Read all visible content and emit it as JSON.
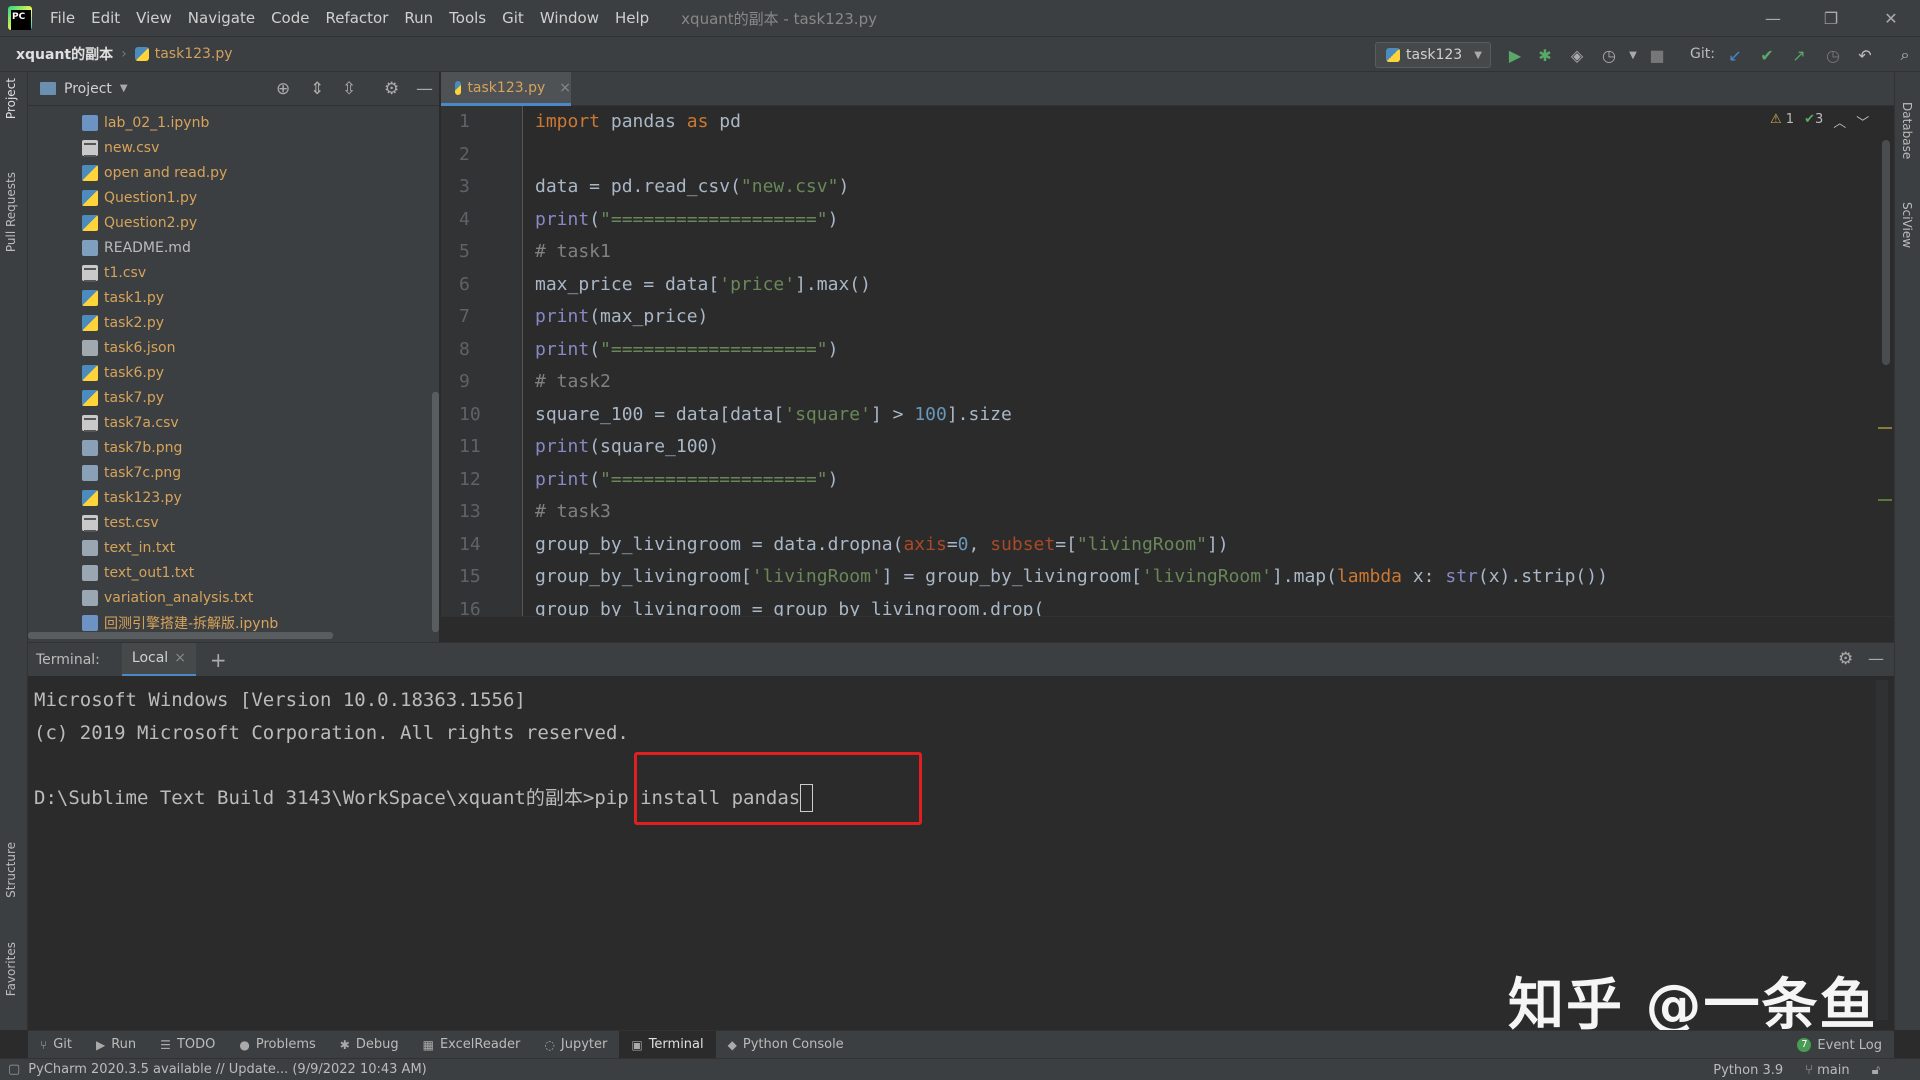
{
  "menubar": {
    "items": [
      "File",
      "Edit",
      "View",
      "Navigate",
      "Code",
      "Refactor",
      "Run",
      "Tools",
      "Git",
      "Window",
      "Help"
    ],
    "window_title": "xquant的副本 - task123.py",
    "minimize": "—",
    "restore": "❐",
    "close": "✕"
  },
  "navbar": {
    "project": "xquant的副本",
    "file": "task123.py",
    "run_config": "task123",
    "git_label": "Git:"
  },
  "left_strip": {
    "project": "Project",
    "pull_requests": "Pull Requests",
    "structure": "Structure",
    "favorites": "Favorites"
  },
  "right_strip": {
    "database": "Database",
    "sciview": "SciView"
  },
  "project_panel": {
    "title": "Project",
    "files": [
      {
        "name": "lab_02_1.ipynb",
        "type": "nb"
      },
      {
        "name": "new.csv",
        "type": "csv"
      },
      {
        "name": "open and read.py",
        "type": "py"
      },
      {
        "name": "Question1.py",
        "type": "py"
      },
      {
        "name": "Question2.py",
        "type": "py"
      },
      {
        "name": "README.md",
        "type": "md"
      },
      {
        "name": "t1.csv",
        "type": "csv"
      },
      {
        "name": "task1.py",
        "type": "py"
      },
      {
        "name": "task2.py",
        "type": "py"
      },
      {
        "name": "task6.json",
        "type": "json"
      },
      {
        "name": "task6.py",
        "type": "py"
      },
      {
        "name": "task7.py",
        "type": "py"
      },
      {
        "name": "task7a.csv",
        "type": "csv"
      },
      {
        "name": "task7b.png",
        "type": "png"
      },
      {
        "name": "task7c.png",
        "type": "png"
      },
      {
        "name": "task123.py",
        "type": "py"
      },
      {
        "name": "test.csv",
        "type": "csv"
      },
      {
        "name": "text_in.txt",
        "type": "txt"
      },
      {
        "name": "text_out1.txt",
        "type": "txt"
      },
      {
        "name": "variation_analysis.txt",
        "type": "txt"
      },
      {
        "name": "回测引擎搭建-拆解版.ipynb",
        "type": "nb"
      }
    ]
  },
  "editor": {
    "tab": "task123.py",
    "inspections": {
      "warnings": "1",
      "ok": "3"
    },
    "line_numbers": [
      "1",
      "2",
      "3",
      "4",
      "5",
      "6",
      "7",
      "8",
      "9",
      "10",
      "11",
      "12",
      "13",
      "14",
      "15",
      "16"
    ],
    "lines": [
      [
        [
          "kw",
          "import"
        ],
        [
          "fn",
          " pandas "
        ],
        [
          "kw",
          "as"
        ],
        [
          "fn",
          " pd"
        ]
      ],
      [],
      [
        [
          "fn",
          "data = pd.read_csv("
        ],
        [
          "st",
          "\"new.csv\""
        ],
        [
          "fn",
          ")"
        ]
      ],
      [
        [
          "bi",
          "print"
        ],
        [
          "fn",
          "("
        ],
        [
          "st",
          "\"===================\""
        ],
        [
          "fn",
          ")"
        ]
      ],
      [
        [
          "cm",
          "# task1"
        ]
      ],
      [
        [
          "fn",
          "max_price = data["
        ],
        [
          "st",
          "'price'"
        ],
        [
          "fn",
          "].max()"
        ]
      ],
      [
        [
          "bi",
          "print"
        ],
        [
          "fn",
          "(max_price)"
        ]
      ],
      [
        [
          "bi",
          "print"
        ],
        [
          "fn",
          "("
        ],
        [
          "st",
          "\"===================\""
        ],
        [
          "fn",
          ")"
        ]
      ],
      [
        [
          "cm",
          "# task2"
        ]
      ],
      [
        [
          "fn",
          "square_100 = data[data["
        ],
        [
          "st",
          "'square'"
        ],
        [
          "fn",
          "] > "
        ],
        [
          "nm",
          "100"
        ],
        [
          "fn",
          "].size"
        ]
      ],
      [
        [
          "bi",
          "print"
        ],
        [
          "fn",
          "(square_100)"
        ]
      ],
      [
        [
          "bi",
          "print"
        ],
        [
          "fn",
          "("
        ],
        [
          "st",
          "\"===================\""
        ],
        [
          "fn",
          ")"
        ]
      ],
      [
        [
          "cm",
          "# task3"
        ]
      ],
      [
        [
          "fn",
          "group_by_livingroom = data.dropna("
        ],
        [
          "pr",
          "axis"
        ],
        [
          "fn",
          "="
        ],
        [
          "nm",
          "0"
        ],
        [
          "fn",
          ", "
        ],
        [
          "pr",
          "subset"
        ],
        [
          "fn",
          "=["
        ],
        [
          "st",
          "\"livingRoom\""
        ],
        [
          "fn",
          "])"
        ]
      ],
      [
        [
          "fn",
          "group_by_livingroom["
        ],
        [
          "st",
          "'livingRoom'"
        ],
        [
          "fn",
          "] = group_by_livingroom["
        ],
        [
          "st",
          "'livingRoom'"
        ],
        [
          "fn",
          "].map("
        ],
        [
          "kw",
          "lambda"
        ],
        [
          "fn",
          " x: "
        ],
        [
          "bi",
          "str"
        ],
        [
          "fn",
          "(x).strip())"
        ]
      ],
      [
        [
          "fn",
          "group_by_livingroom = group_by_livingroom.drop("
        ]
      ]
    ]
  },
  "terminal": {
    "label": "Terminal:",
    "tab": "Local",
    "lines": [
      "Microsoft Windows [Version 10.0.18363.1556]",
      "(c) 2019 Microsoft Corporation. All rights reserved.",
      ""
    ],
    "prompt": "D:\\Sublime Text Build 3143\\WorkSpace\\xquant的副本",
    "command": ">pip install pandas"
  },
  "watermark": "知乎 @一条鱼",
  "toolwindows": [
    {
      "label": "Git",
      "icon": "⑂"
    },
    {
      "label": "Run",
      "icon": "▶"
    },
    {
      "label": "TODO",
      "icon": "☰"
    },
    {
      "label": "Problems",
      "icon": "●"
    },
    {
      "label": "Debug",
      "icon": "✱"
    },
    {
      "label": "ExcelReader",
      "icon": "▦"
    },
    {
      "label": "Jupyter",
      "icon": "◌"
    },
    {
      "label": "Terminal",
      "icon": "▣"
    },
    {
      "label": "Python Console",
      "icon": "◆"
    }
  ],
  "event_log": {
    "label": "Event Log",
    "count": "7"
  },
  "statusbar": {
    "message": "PyCharm 2020.3.5 available // Update... (9/9/2022 10:43 AM)",
    "interpreter": "Python 3.9",
    "branch": "main"
  }
}
